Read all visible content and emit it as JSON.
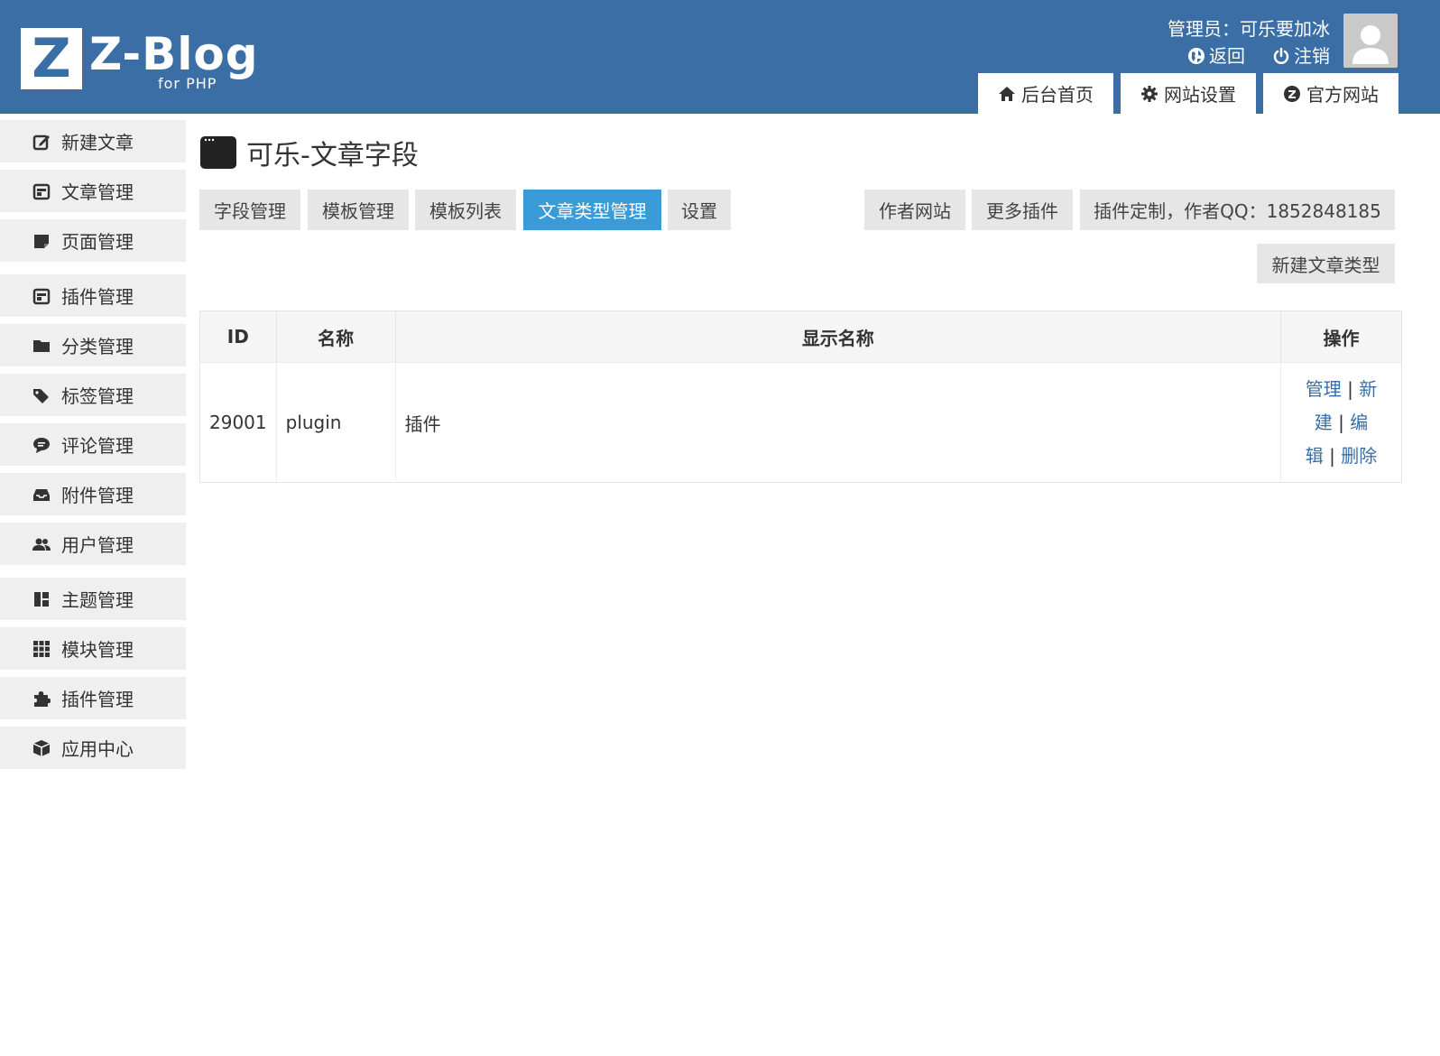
{
  "brand": {
    "logo_letter": "Z",
    "name": "Z-Blog",
    "sub": "for PHP",
    "color": "#3a6ea5"
  },
  "user": {
    "label": "管理员：可乐要加冰",
    "back_label": "返回",
    "logout_label": "注销"
  },
  "top_tabs": [
    {
      "label": "后台首页",
      "icon": "home-icon"
    },
    {
      "label": "网站设置",
      "icon": "gear-icon"
    },
    {
      "label": "官方网站",
      "icon": "zblog-icon"
    }
  ],
  "sidebar": {
    "items": [
      {
        "label": "新建文章",
        "icon": "edit-icon"
      },
      {
        "label": "文章管理",
        "icon": "article-icon"
      },
      {
        "label": "页面管理",
        "icon": "page-icon"
      },
      {
        "label": "插件管理",
        "icon": "article-icon"
      },
      {
        "label": "分类管理",
        "icon": "folder-icon"
      },
      {
        "label": "标签管理",
        "icon": "tags-icon"
      },
      {
        "label": "评论管理",
        "icon": "comment-icon"
      },
      {
        "label": "附件管理",
        "icon": "inbox-icon"
      },
      {
        "label": "用户管理",
        "icon": "users-icon"
      },
      {
        "label": "主题管理",
        "icon": "theme-icon"
      },
      {
        "label": "模块管理",
        "icon": "grid-icon"
      },
      {
        "label": "插件管理",
        "icon": "puzzle-icon"
      },
      {
        "label": "应用中心",
        "icon": "box-icon"
      }
    ]
  },
  "page": {
    "title": "可乐-文章字段",
    "tabs": [
      "字段管理",
      "模板管理",
      "模板列表",
      "文章类型管理",
      "设置"
    ],
    "active_tab": "文章类型管理",
    "right_tabs": [
      "作者网站",
      "更多插件",
      "插件定制，作者QQ：1852848185"
    ],
    "new_button": "新建文章类型",
    "accent": "#3a9bd9"
  },
  "table": {
    "headers": [
      "ID",
      "名称",
      "显示名称",
      "操作"
    ],
    "rows": [
      {
        "id": "29001",
        "name": "plugin",
        "display": "插件",
        "ops": {
          "manage": "管理",
          "new_1": "新",
          "new_2": "建",
          "edit_1": "编",
          "edit_2": "辑",
          "delete": "删除",
          "sep": "|"
        }
      }
    ]
  }
}
